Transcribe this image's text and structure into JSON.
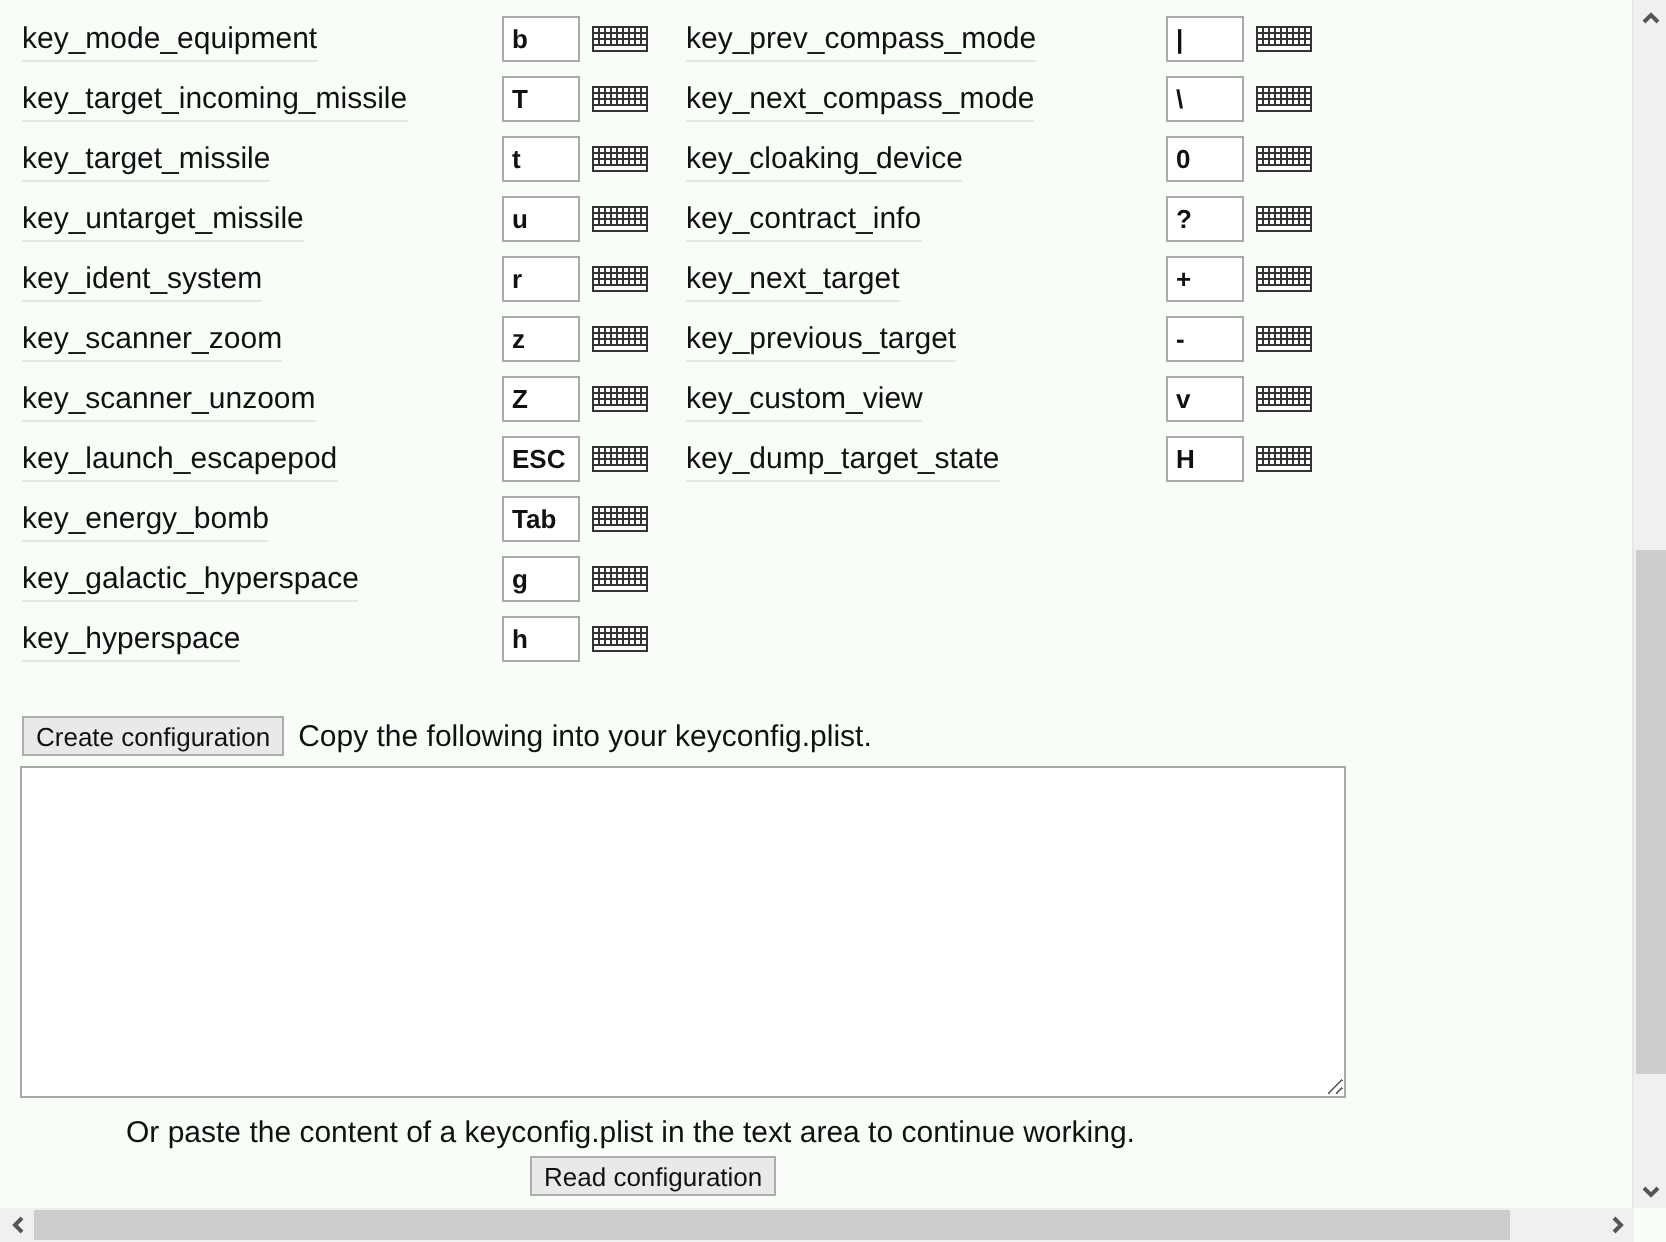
{
  "bindings": {
    "column_1": [
      {
        "name": "key_mode_equipment",
        "key": "b"
      },
      {
        "name": "key_target_incoming_missile",
        "key": "T"
      },
      {
        "name": "key_target_missile",
        "key": "t"
      },
      {
        "name": "key_untarget_missile",
        "key": "u"
      },
      {
        "name": "key_ident_system",
        "key": "r"
      },
      {
        "name": "key_scanner_zoom",
        "key": "z"
      },
      {
        "name": "key_scanner_unzoom",
        "key": "Z"
      },
      {
        "name": "key_launch_escapepod",
        "key": "ESC"
      },
      {
        "name": "key_energy_bomb",
        "key": "Tab"
      },
      {
        "name": "key_galactic_hyperspace",
        "key": "g"
      },
      {
        "name": "key_hyperspace",
        "key": "h"
      }
    ],
    "column_2": [
      {
        "name": "key_prev_compass_mode",
        "key": "|"
      },
      {
        "name": "key_next_compass_mode",
        "key": "\\"
      },
      {
        "name": "key_cloaking_device",
        "key": "0"
      },
      {
        "name": "key_contract_info",
        "key": "?"
      },
      {
        "name": "key_next_target",
        "key": "+"
      },
      {
        "name": "key_previous_target",
        "key": "-"
      },
      {
        "name": "key_custom_view",
        "key": "v"
      },
      {
        "name": "key_dump_target_state",
        "key": "H"
      }
    ]
  },
  "create_button": "Create configuration",
  "copy_hint": "Copy the following into your keyconfig.plist.",
  "paste_hint": "Or paste the content of a keyconfig.plist in the text area to continue working.",
  "read_button": "Read configuration"
}
